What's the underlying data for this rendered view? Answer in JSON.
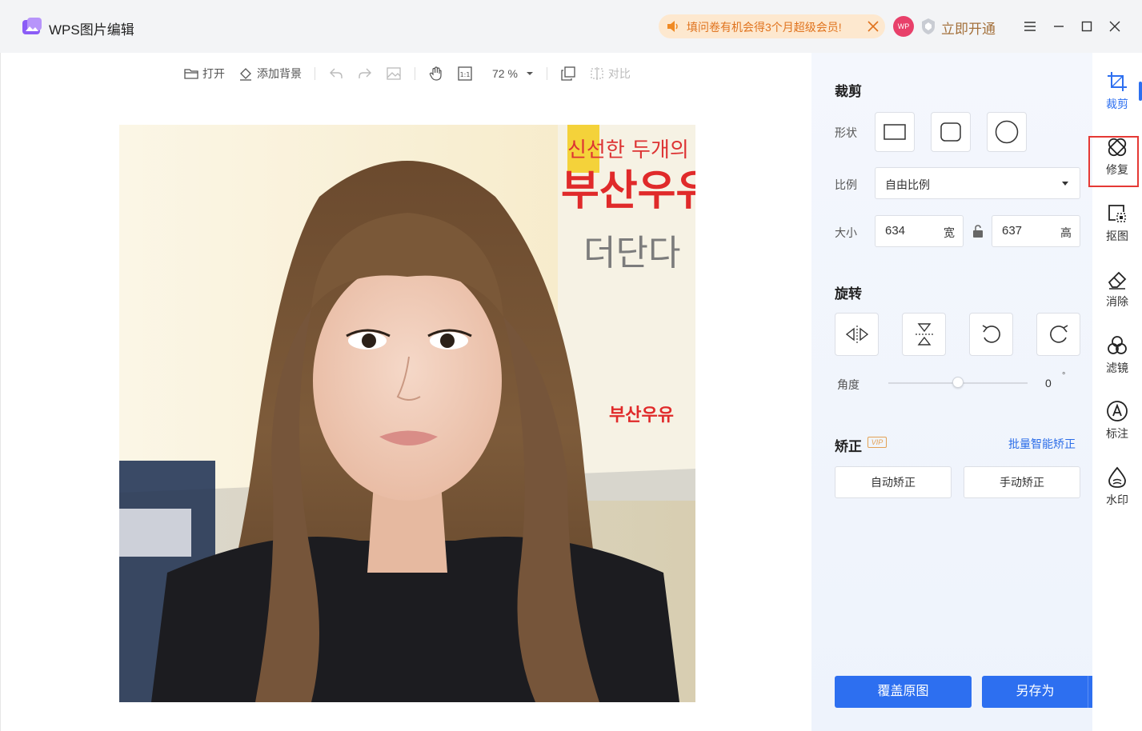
{
  "app": {
    "title": "WPS图片编辑"
  },
  "promo": {
    "text": "填问卷有机会得3个月超级会员!"
  },
  "user": {
    "avatar_text": "WP",
    "open_vip": "立即开通"
  },
  "toolbar": {
    "open": "打开",
    "add_background": "添加背景",
    "zoom": "72 %",
    "compare": "对比"
  },
  "photo": {
    "sign_text_1": "신선한 두개의 얼음",
    "sign_text_2": "부산우유",
    "sign_text_3": "더단다",
    "sign_text_4": "부산우유"
  },
  "crop": {
    "title": "裁剪",
    "shape_label": "形状",
    "ratio_label": "比例",
    "ratio_value": "自由比例",
    "size_label": "大小",
    "width_value": "634",
    "width_unit": "宽",
    "height_value": "637",
    "height_unit": "高"
  },
  "rotate": {
    "title": "旋转",
    "angle_label": "角度",
    "angle_value": "0",
    "angle_unit": "°",
    "angle_fraction": 0.5
  },
  "correct": {
    "title": "矫正",
    "vip": "VIP",
    "batch_link": "批量智能矫正",
    "auto": "自动矫正",
    "manual": "手动矫正"
  },
  "actions": {
    "overwrite": "覆盖原图",
    "save_as": "另存为"
  },
  "nav": [
    {
      "label": "裁剪",
      "icon": "crop-icon",
      "active": true
    },
    {
      "label": "修复",
      "icon": "repair-icon",
      "active": false
    },
    {
      "label": "抠图",
      "icon": "cutout-icon",
      "active": false
    },
    {
      "label": "消除",
      "icon": "eraser-icon",
      "active": false
    },
    {
      "label": "滤镜",
      "icon": "filter-icon",
      "active": false
    },
    {
      "label": "标注",
      "icon": "annotate-icon",
      "active": false
    },
    {
      "label": "水印",
      "icon": "watermark-icon",
      "active": false
    }
  ],
  "colors": {
    "accent": "#2d6ff0",
    "vip": "#a4713c",
    "promo": "#e0731e",
    "highlight": "#e53935"
  }
}
